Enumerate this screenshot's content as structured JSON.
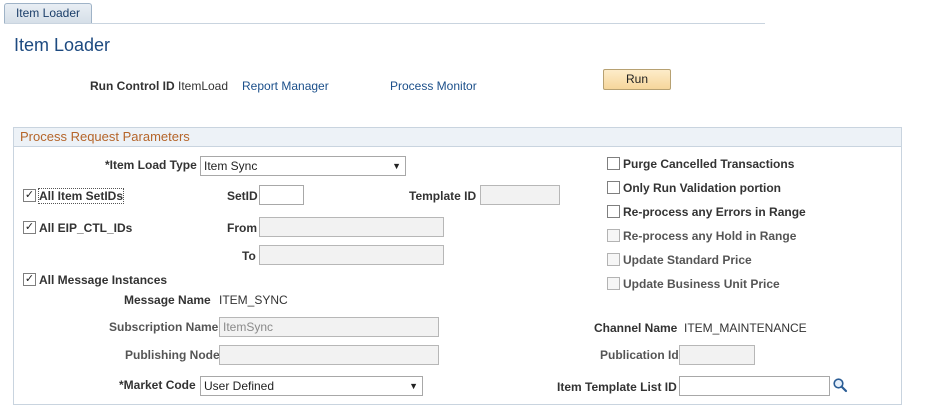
{
  "tab": {
    "label": "Item Loader"
  },
  "page_title": "Item Loader",
  "run_control": {
    "label": "Run Control ID",
    "value": "ItemLoad",
    "report_manager": "Report Manager",
    "process_monitor": "Process Monitor",
    "run_button": "Run"
  },
  "section": {
    "title": "Process Request Parameters",
    "item_load_type": {
      "label": "*Item Load Type",
      "value": "Item Sync"
    },
    "all_item_setids": {
      "label": "All Item SetIDs",
      "checked": true
    },
    "setid": {
      "label": "SetID",
      "value": ""
    },
    "template_id": {
      "label": "Template ID",
      "value": ""
    },
    "all_eip_ctl_ids": {
      "label": "All EIP_CTL_IDs",
      "checked": true
    },
    "from": {
      "label": "From",
      "value": ""
    },
    "to": {
      "label": "To",
      "value": ""
    },
    "all_message_instances": {
      "label": "All Message Instances",
      "checked": true
    },
    "message_name": {
      "label": "Message Name",
      "value": "ITEM_SYNC"
    },
    "subscription_name": {
      "label": "Subscription Name",
      "value": "ItemSync"
    },
    "publishing_node": {
      "label": "Publishing Node",
      "value": ""
    },
    "market_code": {
      "label": "*Market Code",
      "value": "User Defined"
    },
    "right_checkboxes": [
      {
        "label": "Purge Cancelled Transactions",
        "checked": false,
        "enabled": true
      },
      {
        "label": "Only Run Validation portion",
        "checked": false,
        "enabled": true
      },
      {
        "label": "Re-process any Errors in Range",
        "checked": false,
        "enabled": true
      },
      {
        "label": "Re-process any Hold in Range",
        "checked": false,
        "enabled": false
      },
      {
        "label": "Update Standard Price",
        "checked": false,
        "enabled": false
      },
      {
        "label": "Update Business Unit Price",
        "checked": false,
        "enabled": false
      }
    ],
    "channel_name": {
      "label": "Channel Name",
      "value": "ITEM_MAINTENANCE"
    },
    "publication_id": {
      "label": "Publication Id",
      "value": ""
    },
    "item_template_list_id": {
      "label": "Item Template List ID",
      "value": ""
    }
  },
  "icons": {
    "lookup": "magnifier-icon",
    "checkmark": "✓"
  },
  "colors": {
    "accent": "#1d4a80",
    "section_title": "#b5652a",
    "run_button": "#f6d69b"
  }
}
